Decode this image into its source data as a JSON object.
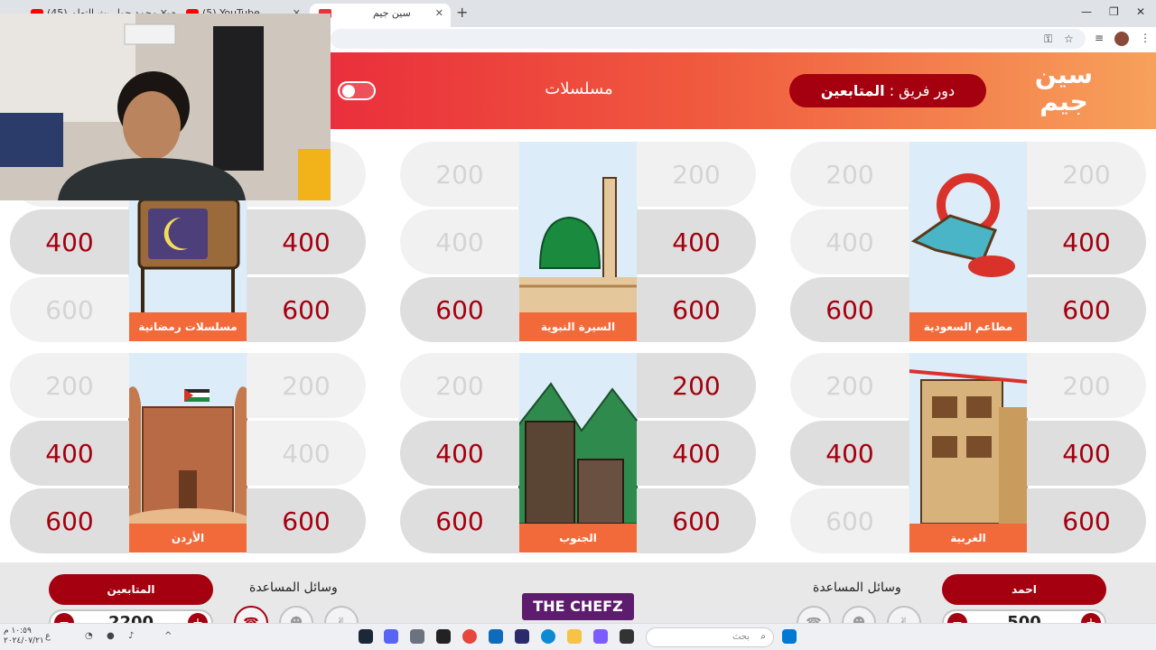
{
  "browser": {
    "tabs": [
      {
        "title": "(45) بث أحمد محمد حول بث التعلم",
        "icon": "youtube-icon"
      },
      {
        "title": "(5) YouTube",
        "icon": "youtube-icon"
      },
      {
        "title": "سين جيم",
        "icon": "seenjeem-icon",
        "active": true
      }
    ],
    "new_tab": "+",
    "window_controls": [
      "—",
      "❐",
      "✕"
    ]
  },
  "header": {
    "logo": "سين جيم",
    "turn_prefix": "دور فريق : ",
    "turn_team": "المتابعين",
    "category_title": "مسلسلات"
  },
  "board": {
    "cards": [
      {
        "label": "مطاعم السعودية",
        "icon": "restaurant-icon"
      },
      {
        "label": "السيرة النبوية",
        "icon": "mosque-icon"
      },
      {
        "label": "مسلسلات رمضانية",
        "icon": "tv-icon"
      },
      {
        "label": "الغربية",
        "icon": "old-building-icon"
      },
      {
        "label": "الجنوب",
        "icon": "mountain-village-icon"
      },
      {
        "label": "الأردن",
        "icon": "petra-icon"
      }
    ],
    "cells": [
      {
        "value": "200",
        "state": "used"
      },
      {
        "value": "200",
        "state": "used"
      },
      {
        "value": "400",
        "state": "avail"
      },
      {
        "value": "400",
        "state": "used"
      },
      {
        "value": "600",
        "state": "avail"
      },
      {
        "value": "600",
        "state": "avail"
      },
      {
        "value": "200",
        "state": "used"
      },
      {
        "value": "200",
        "state": "used"
      },
      {
        "value": "400",
        "state": "avail"
      },
      {
        "value": "400",
        "state": "used"
      },
      {
        "value": "600",
        "state": "avail"
      },
      {
        "value": "600",
        "state": "avail"
      },
      {
        "value": "200",
        "state": "used"
      },
      {
        "value": "200",
        "state": "used"
      },
      {
        "value": "400",
        "state": "avail"
      },
      {
        "value": "400",
        "state": "avail"
      },
      {
        "value": "600",
        "state": "avail"
      },
      {
        "value": "600",
        "state": "used"
      },
      {
        "value": "200",
        "state": "used"
      },
      {
        "value": "200",
        "state": "used"
      },
      {
        "value": "400",
        "state": "avail"
      },
      {
        "value": "400",
        "state": "avail"
      },
      {
        "value": "600",
        "state": "avail"
      },
      {
        "value": "600",
        "state": "used"
      },
      {
        "value": "200",
        "state": "avail"
      },
      {
        "value": "200",
        "state": "used"
      },
      {
        "value": "400",
        "state": "avail"
      },
      {
        "value": "400",
        "state": "avail"
      },
      {
        "value": "600",
        "state": "avail"
      },
      {
        "value": "600",
        "state": "avail"
      },
      {
        "value": "200",
        "state": "used"
      },
      {
        "value": "200",
        "state": "used"
      },
      {
        "value": "400",
        "state": "used"
      },
      {
        "value": "400",
        "state": "avail"
      },
      {
        "value": "600",
        "state": "avail"
      },
      {
        "value": "600",
        "state": "avail"
      }
    ]
  },
  "bottom": {
    "left_team": {
      "name": "المتابعين",
      "score": "2200",
      "aids_label": "وسائل المساعدة"
    },
    "right_team": {
      "name": "احمد",
      "score": "500",
      "aids_label": "وسائل المساعدة"
    },
    "sponsor": "THE CHEFZ"
  },
  "taskbar": {
    "search_placeholder": "بحث",
    "clock_time": "١٠:٥٩ م",
    "clock_date": "٢٠٢٤/٠٧/٢١"
  },
  "colors": {
    "accent": "#a4000f",
    "header_start": "#ea2f3c",
    "header_end": "#f7a15b",
    "card_label": "#f26a3a"
  }
}
